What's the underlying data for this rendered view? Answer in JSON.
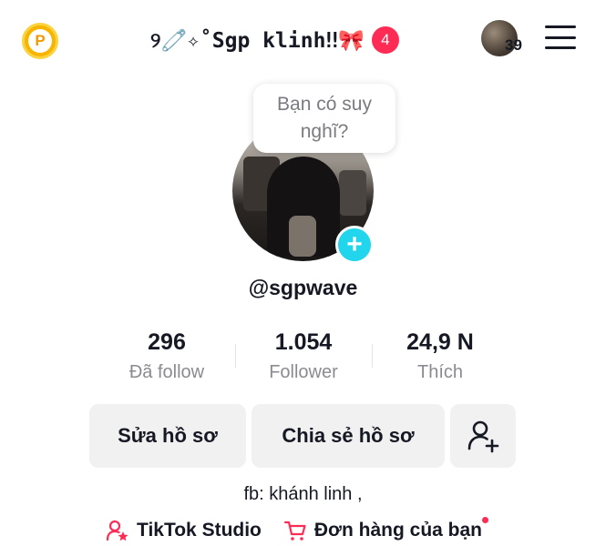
{
  "header": {
    "coin_letter": "P",
    "title": "୨🧷✧˚Sgp klinh‼🎀",
    "notification_count": "4",
    "friends_count": "39"
  },
  "profile": {
    "thought_bubble": "Bạn có suy nghĩ?",
    "add_symbol": "+",
    "username": "@sgpwave",
    "bio": "fb: khánh linh ,"
  },
  "stats": [
    {
      "value": "296",
      "label": "Đã follow"
    },
    {
      "value": "1.054",
      "label": "Follower"
    },
    {
      "value": "24,9 N",
      "label": "Thích"
    }
  ],
  "actions": {
    "edit_profile": "Sửa hồ sơ",
    "share_profile": "Chia sẻ hồ sơ"
  },
  "links": {
    "studio": "TikTok Studio",
    "orders": "Đơn hàng của bạn"
  },
  "colors": {
    "accent_red": "#fe2c55",
    "accent_cyan": "#20d5ec",
    "coin_gold": "#f7b500"
  }
}
